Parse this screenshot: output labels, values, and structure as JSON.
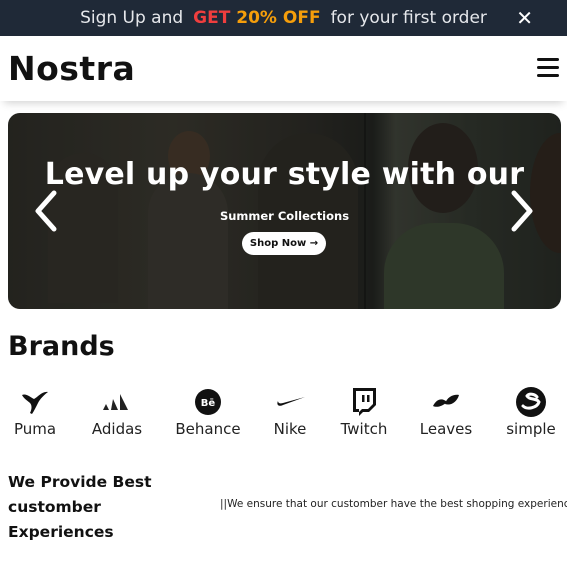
{
  "promo": {
    "pre": "Sign Up and",
    "highlight_get": "GET ",
    "highlight_off": "20% OFF",
    "post": "for your first order",
    "close_icon": "close-icon"
  },
  "header": {
    "logo": "Nostra",
    "menu_icon": "hamburger-menu-icon"
  },
  "hero": {
    "title": "Level up your style with our",
    "subtitle": "Summer Collections",
    "cta_label": "Shop Now →",
    "prev_icon": "chevron-left-icon",
    "next_icon": "chevron-right-icon"
  },
  "brands": {
    "title": "Brands",
    "items": [
      {
        "label": "Puma",
        "icon": "puma-icon"
      },
      {
        "label": "Adidas",
        "icon": "adidas-icon"
      },
      {
        "label": "Behance",
        "icon": "behance-icon"
      },
      {
        "label": "Nike",
        "icon": "nike-icon"
      },
      {
        "label": "Twitch",
        "icon": "twitch-icon"
      },
      {
        "label": "Leaves",
        "icon": "leaves-icon"
      },
      {
        "label": "simple",
        "icon": "simple-icon"
      }
    ]
  },
  "experience": {
    "title_line1": "We Provide Best",
    "title_line2": "customber",
    "title_line3": "Experiences",
    "description": "||We ensure that our customber have the best shopping experiences"
  },
  "colors": {
    "promo_bg": "#1f2937",
    "promo_red": "#ef3e3e",
    "promo_orange": "#f59e0b"
  }
}
